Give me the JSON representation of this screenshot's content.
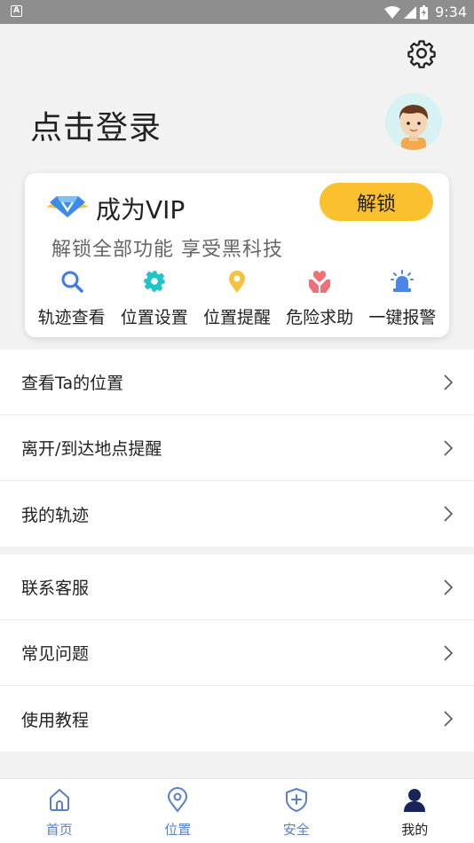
{
  "status_bar": {
    "notification": "A",
    "time": "9:34"
  },
  "header": {
    "login_text": "点击登录"
  },
  "vip": {
    "title": "成为VIP",
    "unlock_label": "解锁",
    "subtitle": "解锁全部功能 享受黑科技",
    "features": [
      {
        "label": "轨迹查看",
        "icon": "search-icon",
        "color": "#3e7be6"
      },
      {
        "label": "位置设置",
        "icon": "gear-icon",
        "color": "#22c3c9"
      },
      {
        "label": "位置提醒",
        "icon": "location-pin-icon",
        "color": "#f5c33b"
      },
      {
        "label": "危险求助",
        "icon": "heart-hands-icon",
        "color": "#f0707a"
      },
      {
        "label": "一键报警",
        "icon": "alarm-icon",
        "color": "#4a86e8"
      }
    ]
  },
  "menu_group_1": [
    {
      "label": "查看Ta的位置"
    },
    {
      "label": "离开/到达地点提醒"
    },
    {
      "label": "我的轨迹"
    }
  ],
  "menu_group_2": [
    {
      "label": "联系客服"
    },
    {
      "label": "常见问题"
    },
    {
      "label": "使用教程"
    }
  ],
  "bottom_nav": [
    {
      "label": "首页",
      "icon": "home-icon"
    },
    {
      "label": "位置",
      "icon": "location-icon"
    },
    {
      "label": "安全",
      "icon": "shield-plus-icon"
    },
    {
      "label": "我的",
      "icon": "person-icon",
      "active": true
    }
  ],
  "colors": {
    "accent": "#fbc02d",
    "nav_inactive": "#5a7fc7"
  }
}
